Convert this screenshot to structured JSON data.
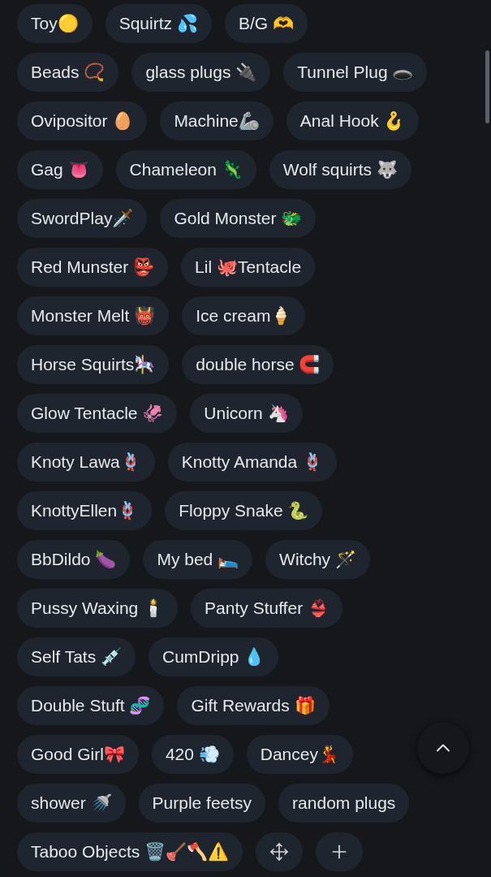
{
  "tag_rows": [
    [
      "Toy🟡",
      "Squirtz 💦",
      "B/G 🫶"
    ],
    [
      "Beads 📿",
      "glass plugs 🔌",
      "Tunnel Plug 🕳️"
    ],
    [
      "Ovipositor 🥚",
      "Machine🦾",
      "Anal Hook 🪝"
    ],
    [
      "Gag 👅",
      "Chameleon 🦎",
      "Wolf squirts 🐺"
    ],
    [
      "SwordPlay🗡️",
      "Gold Monster 🐲"
    ],
    [
      "Red Munster 👺",
      "Lil 🐙Tentacle"
    ],
    [
      "Monster Melt 👹",
      "Ice cream🍦"
    ],
    [
      "Horse Squirts🎠",
      "double horse 🧲"
    ],
    [
      "Glow Tentacle 🦑",
      "Unicorn 🦄"
    ],
    [
      "Knoty Lawa🪢",
      "Knotty Amanda 🪢"
    ],
    [
      "KnottyEllen🪢",
      "Floppy Snake 🐍"
    ],
    [
      "BbDildo 🍆",
      "My bed 🛌",
      "Witchy 🪄"
    ],
    [
      "Pussy Waxing 🕯️",
      "Panty Stuffer 👙"
    ],
    [
      "Self Tats 💉",
      "CumDripp 💧"
    ],
    [
      "Double Stuft 🧬",
      "Gift Rewards 🎁"
    ],
    [
      "Good Girl🎀",
      "420 💨",
      "Dancey💃"
    ],
    [
      "shower 🚿",
      "Purple feetsy",
      "random plugs"
    ],
    [
      "Taboo Objects 🗑️🪠🪓⚠️"
    ]
  ]
}
